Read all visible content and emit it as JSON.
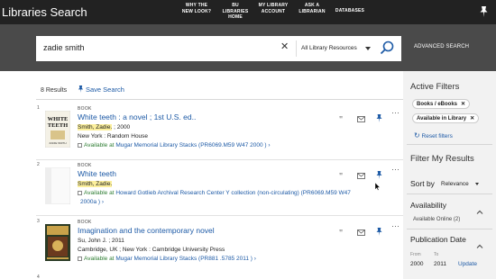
{
  "header": {
    "title": "Libraries Search",
    "nav": [
      {
        "lines": [
          "WHY THE",
          "NEW LOOK?"
        ]
      },
      {
        "lines": [
          "BU",
          "LIBRARIES",
          "HOME"
        ]
      },
      {
        "lines": [
          "MY LIBRARY",
          "ACCOUNT"
        ]
      },
      {
        "lines": [
          "ASK A",
          "LIBRARIAN"
        ]
      },
      {
        "lines": [
          "DATABASES"
        ]
      }
    ],
    "pin_icon": "pin-icon"
  },
  "search": {
    "query": "zadie smith",
    "scope": "All Library Resources",
    "advanced_label": "ADVANCED SEARCH",
    "colors": {
      "band": "#4a4a4a",
      "topbar": "#222222"
    }
  },
  "results": {
    "count_label": "8 Results",
    "save_search_label": "Save Search",
    "records": [
      {
        "number": "1",
        "type": "BOOK",
        "title": "White teeth : a novel ; 1st U.S. ed..",
        "author": "Smith, Zadie.",
        "author_suffix": " ; 2000",
        "publisher": "New York : Random House",
        "availability": "Available at",
        "location": "Mugar Memorial Library Stacks (PR6069.M59 W47 2000 )",
        "location_2": "",
        "cover": {
          "type": "white-teeth",
          "text": "WHITE TEETH",
          "author": "ZADIE SMITH"
        }
      },
      {
        "number": "2",
        "type": "BOOK",
        "title": "White teeth",
        "author": "Smith, Zadie.",
        "author_suffix": "",
        "publisher": "",
        "availability": "Available at",
        "location": "Howard Gotlieb Archival Research Center Y collection (non-circulating) (PR6069.M59 W47",
        "location_2": "2000a )",
        "cover": {
          "type": "blank",
          "text": "",
          "author": ""
        }
      },
      {
        "number": "3",
        "type": "BOOK",
        "title": "Imagination and the contemporary novel",
        "author": "Su, John J. ; 2011",
        "author_suffix": "",
        "publisher": "Cambridge, UK ; New York : Cambridge University Press",
        "availability": "Available at",
        "location": "Mugar Memorial Library Stacks (PR881 .5785 2011 )",
        "location_2": "",
        "cover": {
          "type": "imagination",
          "text": "",
          "author": ""
        }
      }
    ],
    "next_number": "4"
  },
  "sidebar": {
    "active_filters_title": "Active Filters",
    "filters": [
      "Books / eBooks",
      "Available in Library"
    ],
    "reset_label": "Reset filters",
    "filter_title": "Filter My Results",
    "sort_label": "Sort by",
    "sort_value": "Relevance",
    "availability_title": "Availability",
    "availability_value": "Available Online (2)",
    "pubdate_title": "Publication Date",
    "from_label": "From",
    "to_label": "To",
    "from_value": "2000",
    "to_value": "2011",
    "update_label": "Update"
  }
}
